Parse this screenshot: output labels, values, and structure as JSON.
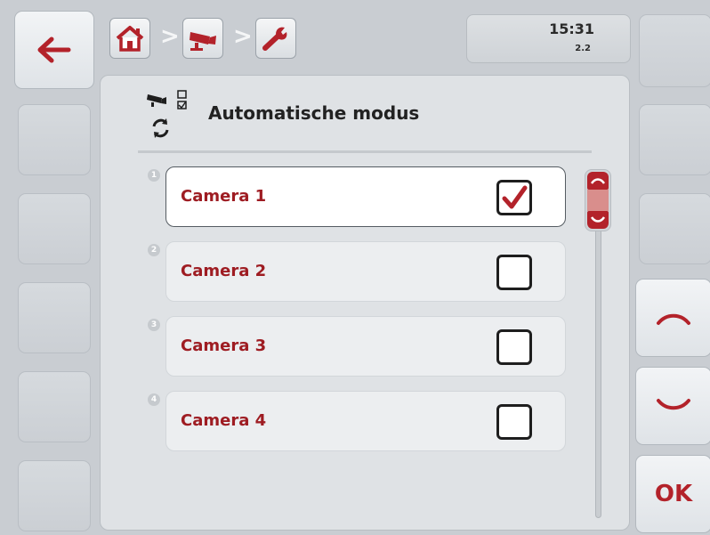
{
  "header": {
    "time": "15:31",
    "version": "2.2",
    "breadcrumb": [
      {
        "icon": "home-icon"
      },
      {
        "icon": "camera-icon"
      },
      {
        "icon": "wrench-icon"
      }
    ],
    "separator": ">"
  },
  "page": {
    "title": "Automatische modus",
    "icon": "camera-auto-mode-icon"
  },
  "list": {
    "items": [
      {
        "number": "1",
        "label": "Camera 1",
        "checked": true
      },
      {
        "number": "2",
        "label": "Camera 2",
        "checked": false
      },
      {
        "number": "3",
        "label": "Camera 3",
        "checked": false
      },
      {
        "number": "4",
        "label": "Camera 4",
        "checked": false
      }
    ]
  },
  "softkeys": {
    "back_icon": "arrow-left-icon",
    "up_icon": "chevron-up-icon",
    "down_icon": "chevron-down-icon",
    "ok_label": "OK"
  },
  "colors": {
    "accent": "#b3222a",
    "label": "#9e1c22"
  }
}
